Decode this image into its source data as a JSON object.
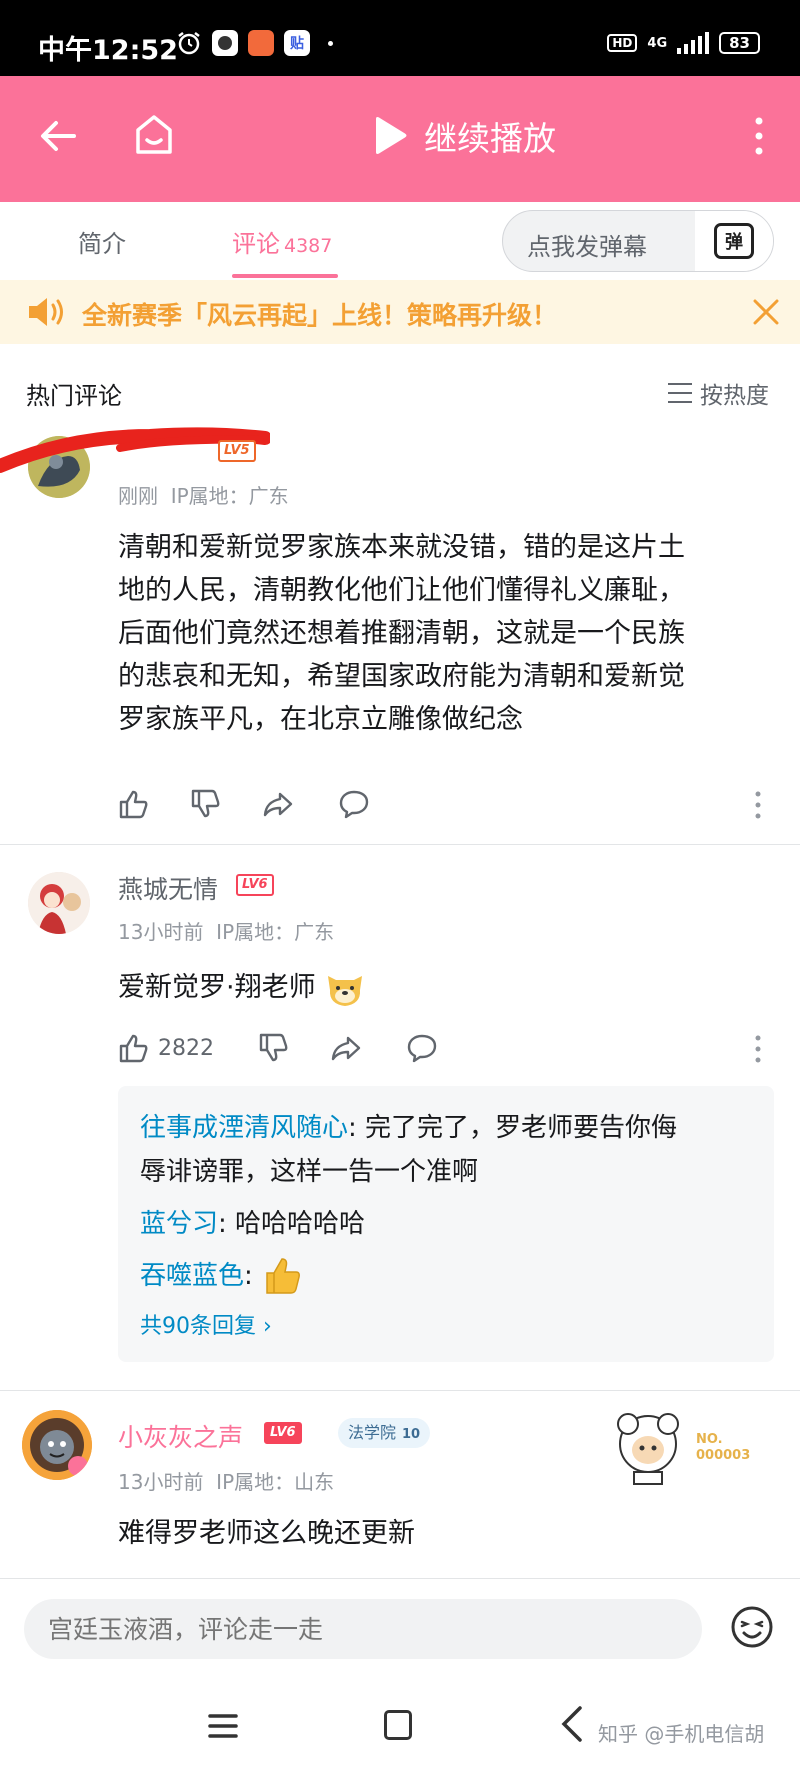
{
  "status_bar": {
    "time": "中午12:52",
    "network": "4G",
    "hd": "HD",
    "battery": "83",
    "notif_icon_label": "贴"
  },
  "header": {
    "title": "继续播放"
  },
  "tabs": {
    "intro": "简介",
    "comments": "评论",
    "comment_count": "4387",
    "danmu_placeholder": "点我发弹幕",
    "danmu_icon_text": "弹"
  },
  "notice": {
    "text": "全新赛季「风云再起」上线！策略再升级！"
  },
  "section": {
    "title": "热门评论",
    "sort_label": "按热度"
  },
  "comments": [
    {
      "level": "LV5",
      "time": "刚刚",
      "ip": "IP属地：广东",
      "text_lines": [
        "清朝和爱新觉罗家族本来就没错，错的是这片土",
        "地的人民，清朝教化他们让他们懂得礼义廉耻，",
        "后面他们竟然还想着推翻清朝，这就是一个民族",
        "的悲哀和无知，希望国家政府能为清朝和爱新觉",
        "罗家族平凡，在北京立雕像做纪念"
      ]
    },
    {
      "name": "燕城无情",
      "level": "LV6",
      "time": "13小时前",
      "ip": "IP属地：广东",
      "text": "爱新觉罗·翔老师",
      "likes": "2822",
      "replies": [
        {
          "name": "往事成湮清风随心",
          "text_line1": ": 完了完了，罗老师要告你侮",
          "text_line2": "辱诽谤罪，这样一告一个准啊"
        },
        {
          "name": "蓝兮习",
          "text": ": 哈哈哈哈哈"
        },
        {
          "name": "吞噬蓝色",
          "text": ":"
        }
      ],
      "more_replies": "共90条回复"
    },
    {
      "name": "小灰灰之声",
      "level": "LV6",
      "badge": "法学院",
      "badge_level": "10",
      "fan_no_label": "NO.",
      "fan_no": "000003",
      "time": "13小时前",
      "ip": "IP属地：山东",
      "text": "难得罗老师这么晚还更新"
    }
  ],
  "input": {
    "placeholder": "宫廷玉液酒，评论走一走"
  },
  "watermark": "知乎 @手机电信胡",
  "colors": {
    "brand_pink": "#fb7299",
    "link_blue": "#008ac5",
    "notice_orange": "#f3a034",
    "level_orange": "#ee672a"
  }
}
